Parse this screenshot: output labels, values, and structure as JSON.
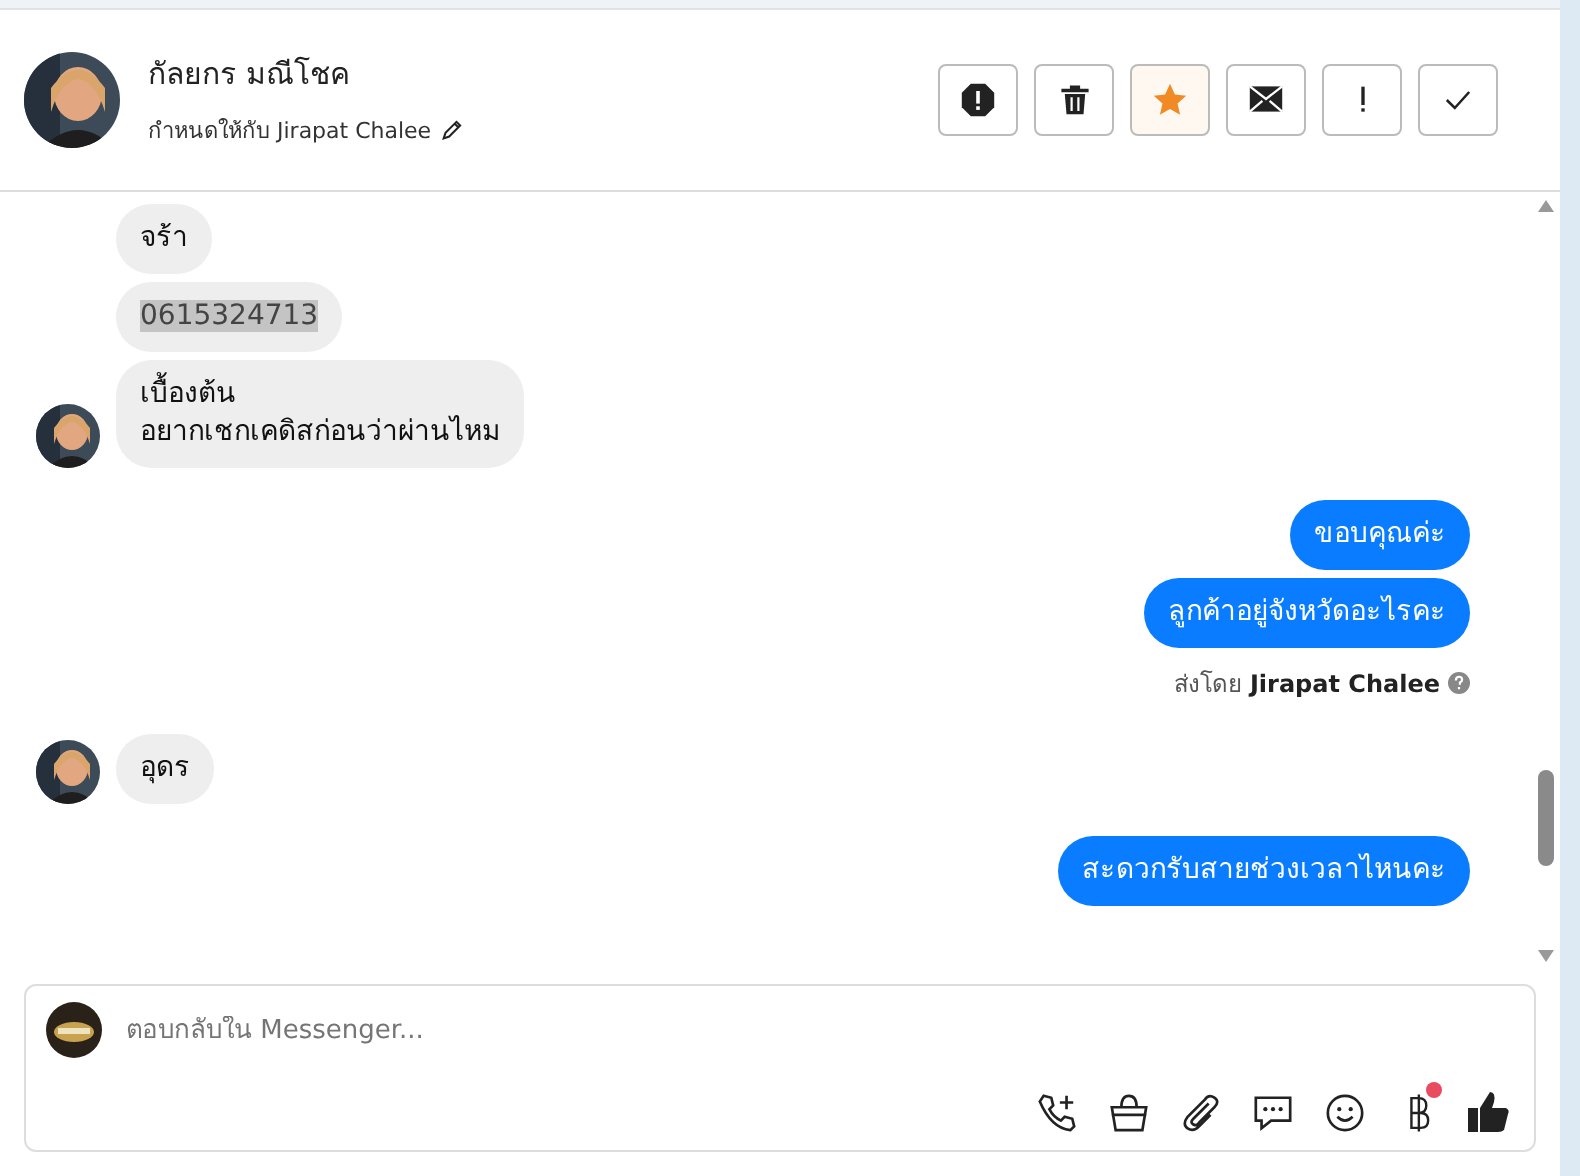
{
  "contact": {
    "name": "กัลยกร มณีโชค",
    "assigned_label": "กำหนดให้กับ",
    "assignee": "Jirapat Chalee"
  },
  "actions": [
    {
      "kind": "alert",
      "on": false
    },
    {
      "kind": "trash",
      "on": false
    },
    {
      "kind": "star",
      "on": true
    },
    {
      "kind": "mail",
      "on": false
    },
    {
      "kind": "exclaim",
      "on": false
    },
    {
      "kind": "check",
      "on": false
    }
  ],
  "groups": [
    {
      "kind": "incoming",
      "messages": [
        {
          "text": "จร้า",
          "highlighted": false
        },
        {
          "text": "0615324713",
          "highlighted": true
        },
        {
          "text": "เบื้องต้น\nอยากเชกเคดิสก่อนว่าผ่านไหม",
          "highlighted": false
        }
      ]
    },
    {
      "kind": "outgoing",
      "messages": [
        {
          "text": "ขอบคุณค่ะ",
          "highlighted": false
        },
        {
          "text": "ลูกค้าอยู่จังหวัดอะไรคะ",
          "highlighted": false
        }
      ],
      "sent_by_label": "ส่งโดย",
      "sent_by": "Jirapat Chalee"
    },
    {
      "kind": "incoming",
      "messages": [
        {
          "text": "อุดร",
          "highlighted": false
        }
      ]
    },
    {
      "kind": "outgoing",
      "messages": [
        {
          "text": "สะดวกรับสายช่วงเวลาไหนคะ",
          "highlighted": false
        }
      ]
    }
  ],
  "composer": {
    "placeholder": "ตอบกลับใน Messenger...",
    "tools": [
      {
        "kind": "call",
        "badge": false
      },
      {
        "kind": "bag",
        "badge": false
      },
      {
        "kind": "clip",
        "badge": false
      },
      {
        "kind": "chat",
        "badge": false
      },
      {
        "kind": "smile",
        "badge": false
      },
      {
        "kind": "baht",
        "badge": true
      },
      {
        "kind": "like",
        "badge": false
      }
    ]
  }
}
